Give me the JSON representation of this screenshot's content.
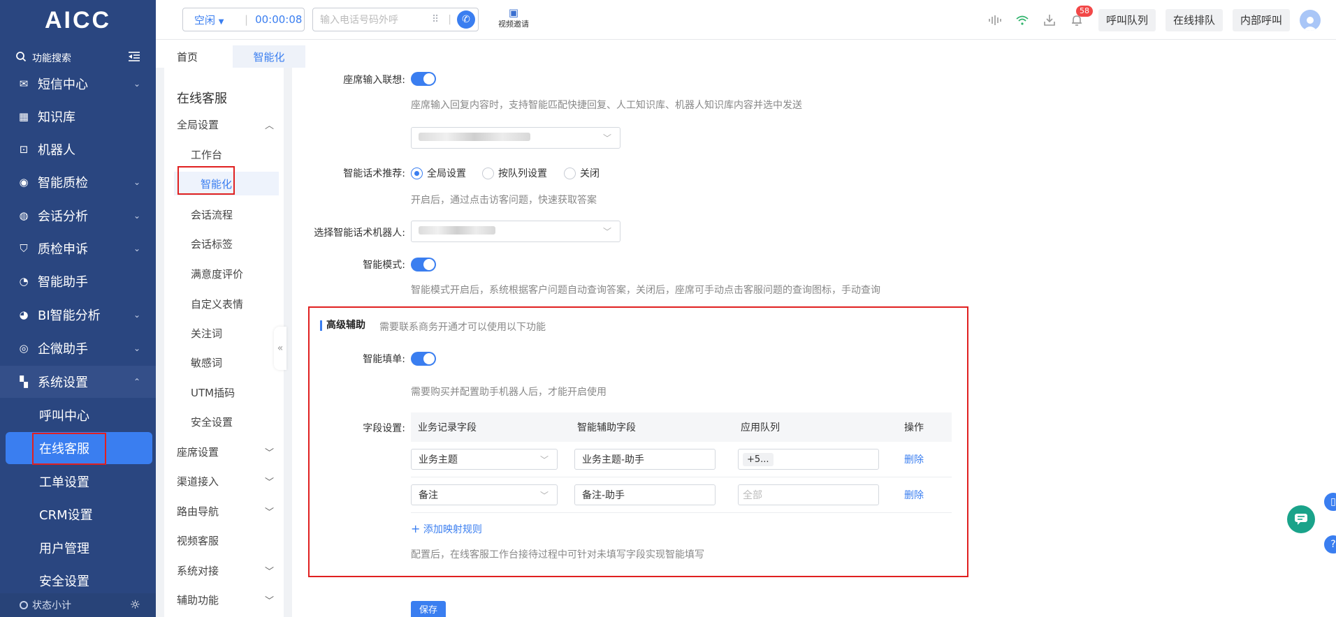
{
  "app": {
    "logo": "AICC"
  },
  "sidebar": {
    "search_label": "功能搜索",
    "items": [
      {
        "label": "短信中心",
        "icon": "sms-icon",
        "arrow": "⌄"
      },
      {
        "label": "知识库",
        "icon": "knowledge-icon",
        "arrow": ""
      },
      {
        "label": "机器人",
        "icon": "robot-icon",
        "arrow": ""
      },
      {
        "label": "智能质检",
        "icon": "quality-icon",
        "arrow": "⌄"
      },
      {
        "label": "会话分析",
        "icon": "chat-analysis-icon",
        "arrow": "⌄"
      },
      {
        "label": "质检申诉",
        "icon": "shield-icon",
        "arrow": "⌄"
      },
      {
        "label": "智能助手",
        "icon": "assistant-icon",
        "arrow": ""
      },
      {
        "label": "BI智能分析",
        "icon": "pie-chart-icon",
        "arrow": "⌄"
      },
      {
        "label": "企微助手",
        "icon": "wecom-icon",
        "arrow": "⌄"
      },
      {
        "label": "系统设置",
        "icon": "grid-icon",
        "arrow": "⌃"
      }
    ],
    "subitems": [
      "呼叫中心",
      "在线客服",
      "工单设置",
      "CRM设置",
      "用户管理",
      "安全设置"
    ],
    "status_label": "状态小计"
  },
  "topbar": {
    "agent_status": "空闲",
    "timer": "00:00:08",
    "phone_placeholder": "输入电话号码外呼",
    "video_label": "视频邀请",
    "notification_count": "58",
    "buttons": [
      "呼叫队列",
      "在线排队",
      "内部呼叫"
    ]
  },
  "tabs": [
    "首页",
    "智能化"
  ],
  "subnav": {
    "title": "在线客服",
    "items": [
      {
        "label": "全局设置",
        "type": "grp",
        "arrow": "︿"
      },
      {
        "label": "工作台",
        "type": "item"
      },
      {
        "label": "智能化",
        "type": "item"
      },
      {
        "label": "会话流程",
        "type": "item"
      },
      {
        "label": "会话标签",
        "type": "item"
      },
      {
        "label": "满意度评价",
        "type": "item"
      },
      {
        "label": "自定义表情",
        "type": "item"
      },
      {
        "label": "关注词",
        "type": "item"
      },
      {
        "label": "敏感词",
        "type": "item"
      },
      {
        "label": "UTM插码",
        "type": "item"
      },
      {
        "label": "安全设置",
        "type": "item"
      },
      {
        "label": "座席设置",
        "type": "grp",
        "arrow": "﹀"
      },
      {
        "label": "渠道接入",
        "type": "grp",
        "arrow": "﹀"
      },
      {
        "label": "路由导航",
        "type": "grp",
        "arrow": "﹀"
      },
      {
        "label": "视频客服",
        "type": "grp",
        "arrow": ""
      },
      {
        "label": "系统对接",
        "type": "grp",
        "arrow": "﹀"
      },
      {
        "label": "辅助功能",
        "type": "grp",
        "arrow": "﹀"
      }
    ]
  },
  "form": {
    "input_assoc_label": "座席输入联想:",
    "input_assoc_hint": "座席输入回复内容时，支持智能匹配快捷回复、人工知识库、机器人知识库内容并选中发送",
    "recommend_label": "智能话术推荐:",
    "recommend_options": [
      "全局设置",
      "按队列设置",
      "关闭"
    ],
    "recommend_hint": "开启后，通过点击访客问题，快速获取答案",
    "robot_label": "选择智能话术机器人:",
    "mode_label": "智能模式:",
    "mode_hint": "智能模式开启后，系统根据客户问题自动查询答案，关闭后，座席可手动点击客服问题的查询图标，手动查询",
    "advanced_title": "高级辅助",
    "advanced_note": "需要联系商务开通才可以使用以下功能",
    "autofill_label": "智能填单:",
    "autofill_hint": "需要购买并配置助手机器人后，才能开启使用",
    "fields_label": "字段设置:",
    "table_headers": [
      "业务记录字段",
      "智能辅助字段",
      "应用队列",
      "操作"
    ],
    "rows": [
      {
        "field": "业务主题",
        "assist": "业务主题-助手",
        "queue": "+5...",
        "queue_is_tag": true,
        "action": "删除"
      },
      {
        "field": "备注",
        "assist": "备注-助手",
        "queue": "全部",
        "queue_is_tag": false,
        "action": "删除"
      }
    ],
    "add_rule": "添加映射规则",
    "bottom_hint": "配置后，在线客服工作台接待过程中可针对未填写字段实现智能填写",
    "save": "保存"
  },
  "colors": {
    "sidebar_bg": "#2a4680",
    "accent": "#3a7ef0",
    "highlight_border": "#e02020",
    "badge": "#f24848",
    "float_green": "#1aa38a"
  }
}
